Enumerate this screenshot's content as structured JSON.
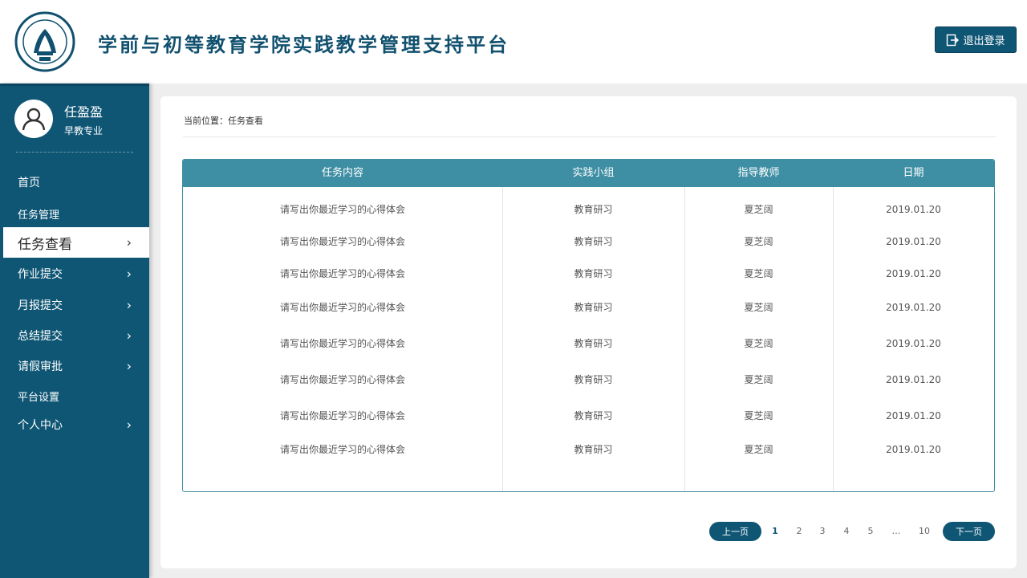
{
  "header": {
    "title": "学前与初等教育学院实践教学管理支持平台",
    "logout_label": "退出登录"
  },
  "user": {
    "name": "任盈盈",
    "major": "早教专业"
  },
  "nav": [
    {
      "label": "首页",
      "chevron": false,
      "active": false
    },
    {
      "label": "任务管理",
      "chevron": false,
      "active": false
    },
    {
      "label": "任务查看",
      "chevron": true,
      "active": true
    },
    {
      "label": "作业提交",
      "chevron": true,
      "active": false
    },
    {
      "label": "月报提交",
      "chevron": true,
      "active": false
    },
    {
      "label": "总结提交",
      "chevron": true,
      "active": false
    },
    {
      "label": "请假审批",
      "chevron": true,
      "active": false
    },
    {
      "label": "平台设置",
      "chevron": false,
      "active": false
    },
    {
      "label": "个人中心",
      "chevron": true,
      "active": false
    }
  ],
  "breadcrumb": "当前位置：任务查看",
  "table": {
    "columns": [
      "任务内容",
      "实践小组",
      "指导教师",
      "日期"
    ],
    "rows": [
      [
        "请写出你最近学习的心得体会",
        "教育研习",
        "夏芝阔",
        "2019.01.20"
      ],
      [
        "请写出你最近学习的心得体会",
        "教育研习",
        "夏芝阔",
        "2019.01.20"
      ],
      [
        "请写出你最近学习的心得体会",
        "教育研习",
        "夏芝阔",
        "2019.01.20"
      ],
      [
        "请写出你最近学习的心得体会",
        "教育研习",
        "夏芝阔",
        "2019.01.20"
      ],
      [
        "请写出你最近学习的心得体会",
        "教育研习",
        "夏芝阔",
        "2019.01.20"
      ],
      [
        "请写出你最近学习的心得体会",
        "教育研习",
        "夏芝阔",
        "2019.01.20"
      ],
      [
        "请写出你最近学习的心得体会",
        "教育研习",
        "夏芝阔",
        "2019.01.20"
      ],
      [
        "请写出你最近学习的心得体会",
        "教育研习",
        "夏芝阔",
        "2019.01.20"
      ]
    ]
  },
  "pagination": {
    "prev_label": "上一页",
    "next_label": "下一页",
    "pages": [
      "1",
      "2",
      "3",
      "4",
      "5",
      "…",
      "10"
    ],
    "current": "1"
  },
  "colors": {
    "primary": "#0f5674",
    "table_header": "#3e8ea4",
    "background": "#eeeeee"
  }
}
